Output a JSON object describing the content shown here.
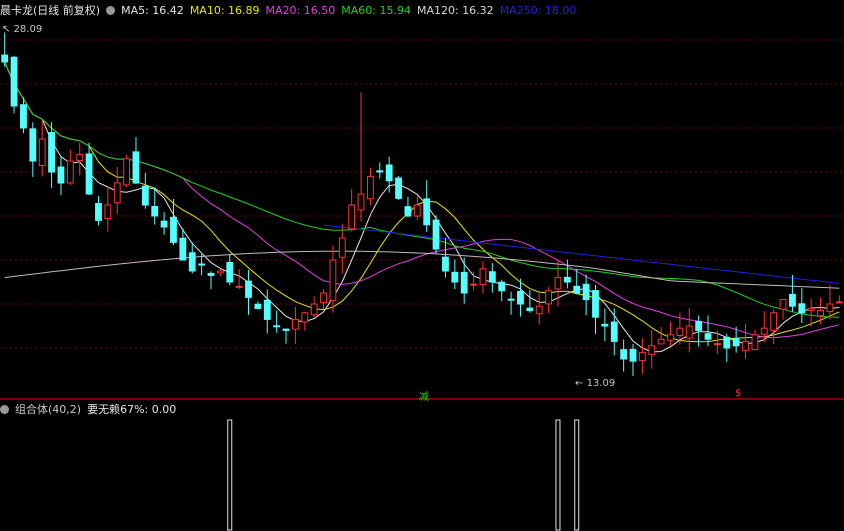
{
  "main_legend": {
    "name": "晨卡龙(日线 前复权)",
    "items": [
      {
        "label": "MA5: 16.42",
        "color": "#e6e6e6"
      },
      {
        "label": "MA10: 16.89",
        "color": "#e6e600"
      },
      {
        "label": "MA20: 16.50",
        "color": "#e040e0"
      },
      {
        "label": "MA60: 15.94",
        "color": "#20d020"
      },
      {
        "label": "MA120: 16.32",
        "color": "#d8d8d8"
      },
      {
        "label": "MA250: 18.00",
        "color": "#2020e0"
      }
    ]
  },
  "sub_legend": {
    "name": "组合体(40,2)",
    "items": [
      {
        "label": "要无赖67%: 0.00",
        "color": "#e6e6e6"
      }
    ]
  },
  "markers": {
    "high_label": "28.09",
    "low_label": "13.09",
    "event_jian": "减",
    "event_dollar": "$"
  },
  "colors": {
    "up": "#ff3232",
    "down": "#54ffff",
    "grid": "#7a0000",
    "ma5": "#e6e6e6",
    "ma10": "#e6e600",
    "ma20": "#e040e0",
    "ma60": "#20d020",
    "ma120": "#bdbdbd",
    "ma250": "#2020e0"
  },
  "chart_data": [
    {
      "type": "candlestick",
      "ylim": [
        12.0,
        29.0
      ],
      "high": 28.09,
      "low": 13.09,
      "close": [
        27.0,
        25.0,
        24.0,
        22.5,
        23.5,
        22.0,
        21.5,
        22.5,
        22.8,
        21.0,
        19.8,
        20.5,
        21.5,
        22.6,
        21.5,
        20.5,
        20.0,
        19.5,
        18.8,
        18.0,
        17.5,
        17.8,
        17.3,
        17.5,
        17.0,
        16.8,
        16.3,
        15.8,
        15.3,
        15.0,
        14.8,
        15.3,
        15.6,
        16.0,
        16.5,
        18.0,
        19.0,
        20.5,
        21.0,
        21.8,
        22.0,
        21.6,
        20.8,
        20.0,
        20.5,
        19.6,
        18.5,
        17.5,
        17.0,
        16.5,
        16.9,
        17.6,
        17.0,
        16.6,
        16.2,
        16.0,
        15.7,
        15.9,
        16.6,
        17.2,
        17.0,
        16.5,
        16.2,
        15.4,
        15.0,
        14.3,
        13.5,
        13.4,
        13.8,
        14.1,
        14.4,
        14.6,
        14.9,
        15.0,
        14.8,
        14.4,
        14.2,
        14.0,
        14.1,
        14.3,
        14.6,
        14.9,
        15.6,
        16.2,
        15.9,
        15.6,
        15.8,
        15.7,
        16.0,
        16.1
      ],
      "ma": {
        "MA5": 16.42,
        "MA10": 16.89,
        "MA20": 16.5,
        "MA60": 15.94,
        "MA120": 16.32,
        "MA250": 18.0
      }
    },
    {
      "type": "bar",
      "name": "组合体(40,2)",
      "spikes": [
        {
          "index": 24,
          "value": 1
        },
        {
          "index": 59,
          "value": 1
        },
        {
          "index": 61,
          "value": 1
        }
      ],
      "ylim": [
        0,
        1
      ]
    }
  ]
}
